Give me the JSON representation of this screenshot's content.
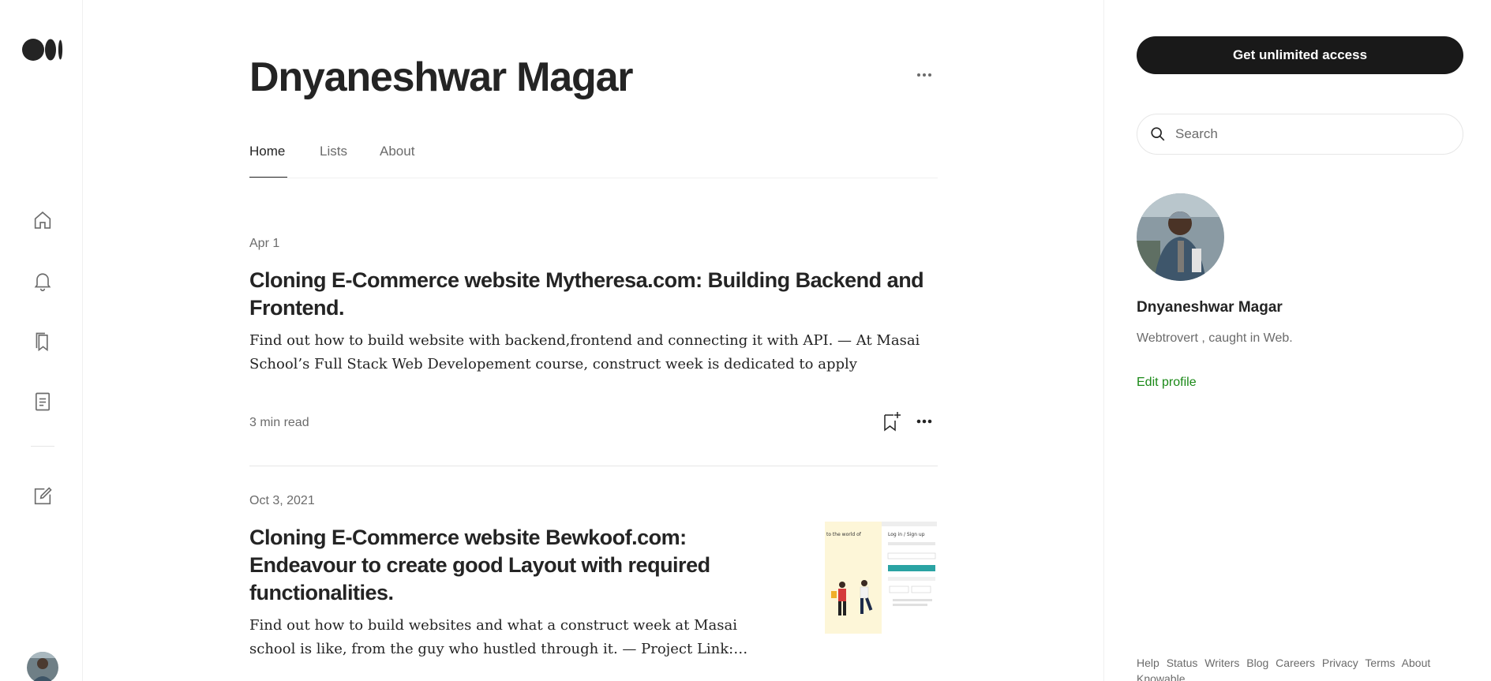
{
  "header": {
    "author_name": "Dnyaneshwar Magar",
    "more_icon": "more-horizontal-icon"
  },
  "left_rail": {
    "logo": "medium-logo",
    "icons": [
      "home-icon",
      "bell-icon",
      "bookmarks-icon",
      "stories-icon",
      "write-icon"
    ]
  },
  "tabs": [
    {
      "label": "Home",
      "active": true
    },
    {
      "label": "Lists",
      "active": false
    },
    {
      "label": "About",
      "active": false
    }
  ],
  "posts": [
    {
      "date": "Apr 1",
      "title": "Cloning E-Commerce website Mytheresa.com: Building Backend and Frontend.",
      "excerpt": "Find out how to build website with backend,frontend and connecting it with API. — At Masai School’s Full Stack Web Developement course, construct week is dedicated to apply everything we…",
      "read_time": "3 min read",
      "has_image": false
    },
    {
      "date": "Oct 3, 2021",
      "title": "Cloning E-Commerce website Bewkoof.com: Endeavour to create good Layout with required functionalities.",
      "excerpt": "Find out how to build websites and what a construct week at Masai school is like, from the guy who hustled through it. — Project Link:…",
      "has_image": true,
      "image": {
        "left_caption": "to the world of",
        "right_title": "Log in / Sign up",
        "accent": "#2aa3a3"
      }
    }
  ],
  "sidebar": {
    "cta_label": "Get unlimited access",
    "search_placeholder": "Search",
    "profile_name": "Dnyaneshwar Magar",
    "profile_bio": "Webtrovert , caught in Web.",
    "edit_profile": "Edit profile",
    "footer_links": [
      "Help",
      "Status",
      "Writers",
      "Blog",
      "Careers",
      "Privacy",
      "Terms",
      "About",
      "Knowable"
    ]
  },
  "colors": {
    "text": "#242424",
    "muted": "#6b6b6b",
    "accent_green": "#1a8917",
    "cta_bg": "#191919"
  }
}
